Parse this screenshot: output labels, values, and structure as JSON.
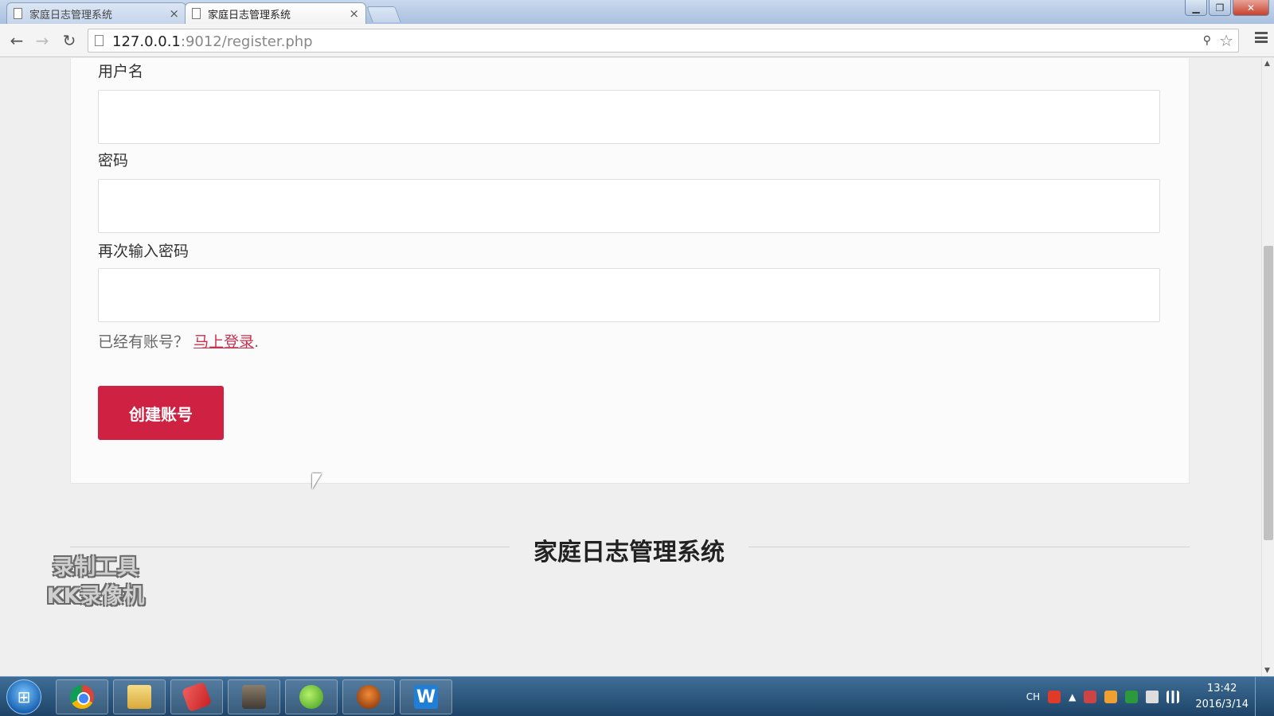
{
  "browser": {
    "tabs": [
      {
        "label": "家庭日志管理系统",
        "close": "×"
      },
      {
        "label": "家庭日志管理系统",
        "close": "×"
      }
    ],
    "window_buttons": {
      "minimize": "▁",
      "maximize": "❐",
      "close": "✕"
    },
    "nav": {
      "back": "←",
      "forward": "→",
      "reload": "↻"
    },
    "url_host": "127.0.0.1",
    "url_rest": ":9012/register.php",
    "star": "☆",
    "key": "⚲"
  },
  "form": {
    "username_label": "用户名",
    "password_label": "密码",
    "confirm_label": "再次输入密码",
    "username_value": "",
    "password_value": "",
    "confirm_value": "",
    "hint_text": "已经有账号？",
    "login_link": "马上登录",
    "hint_suffix": ".",
    "submit_label": "创建账号"
  },
  "footer": {
    "title": "家庭日志管理系统"
  },
  "watermark": {
    "line1": "录制工具",
    "line2": "KK录像机"
  },
  "scrollbar": {
    "up": "▲",
    "down": "▼"
  },
  "taskbar": {
    "start": "⊞",
    "apps": [
      "chrome-icon",
      "folder-icon",
      "eraser-icon",
      "photo-icon",
      "leaf-icon",
      "mask-icon",
      "w-icon"
    ],
    "w_glyph": "W",
    "tray_lang": "CH",
    "tray_up": "▲",
    "time": "13:42",
    "date": "2016/3/14"
  },
  "colors": {
    "accent": "#cf2142",
    "link": "#c9304f"
  }
}
